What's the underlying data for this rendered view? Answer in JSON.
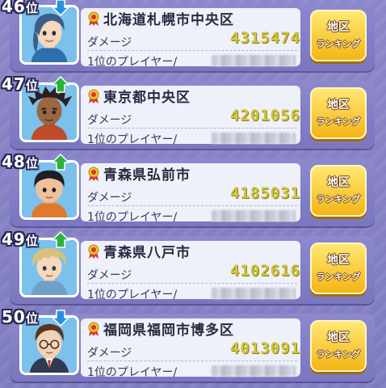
{
  "labels": {
    "damage": "ダメージ",
    "top_player": "1位のプレイヤー/",
    "button_line1": "地区",
    "button_line2": "ランキング"
  },
  "colors": {
    "arrow_up": "#27b43a",
    "arrow_down": "#2a8fe0",
    "value_text": "#cfc53a",
    "button": "#f4b516"
  },
  "rows": [
    {
      "rank_number": "46",
      "rank_suffix": "位",
      "trend": "down",
      "trend_icon": "arrow-down-icon",
      "region": "北海道札幌市中央区",
      "damage": "4315474",
      "avatar": "blue-haired-boy"
    },
    {
      "rank_number": "47",
      "rank_suffix": "位",
      "trend": "up",
      "trend_icon": "arrow-up-icon",
      "region": "東京都中央区",
      "damage": "4201056",
      "avatar": "dreadlocks-boy"
    },
    {
      "rank_number": "48",
      "rank_suffix": "位",
      "trend": "up",
      "trend_icon": "arrow-up-icon",
      "region": "青森県弘前市",
      "damage": "4185031",
      "avatar": "black-haired-boy"
    },
    {
      "rank_number": "49",
      "rank_suffix": "位",
      "trend": "up",
      "trend_icon": "arrow-up-icon",
      "region": "青森県八戸市",
      "damage": "4102616",
      "avatar": "blond-haired-boy"
    },
    {
      "rank_number": "50",
      "rank_suffix": "位",
      "trend": "down",
      "trend_icon": "arrow-down-icon",
      "region": "福岡県福岡市博多区",
      "damage": "4013091",
      "avatar": "glasses-man"
    }
  ]
}
